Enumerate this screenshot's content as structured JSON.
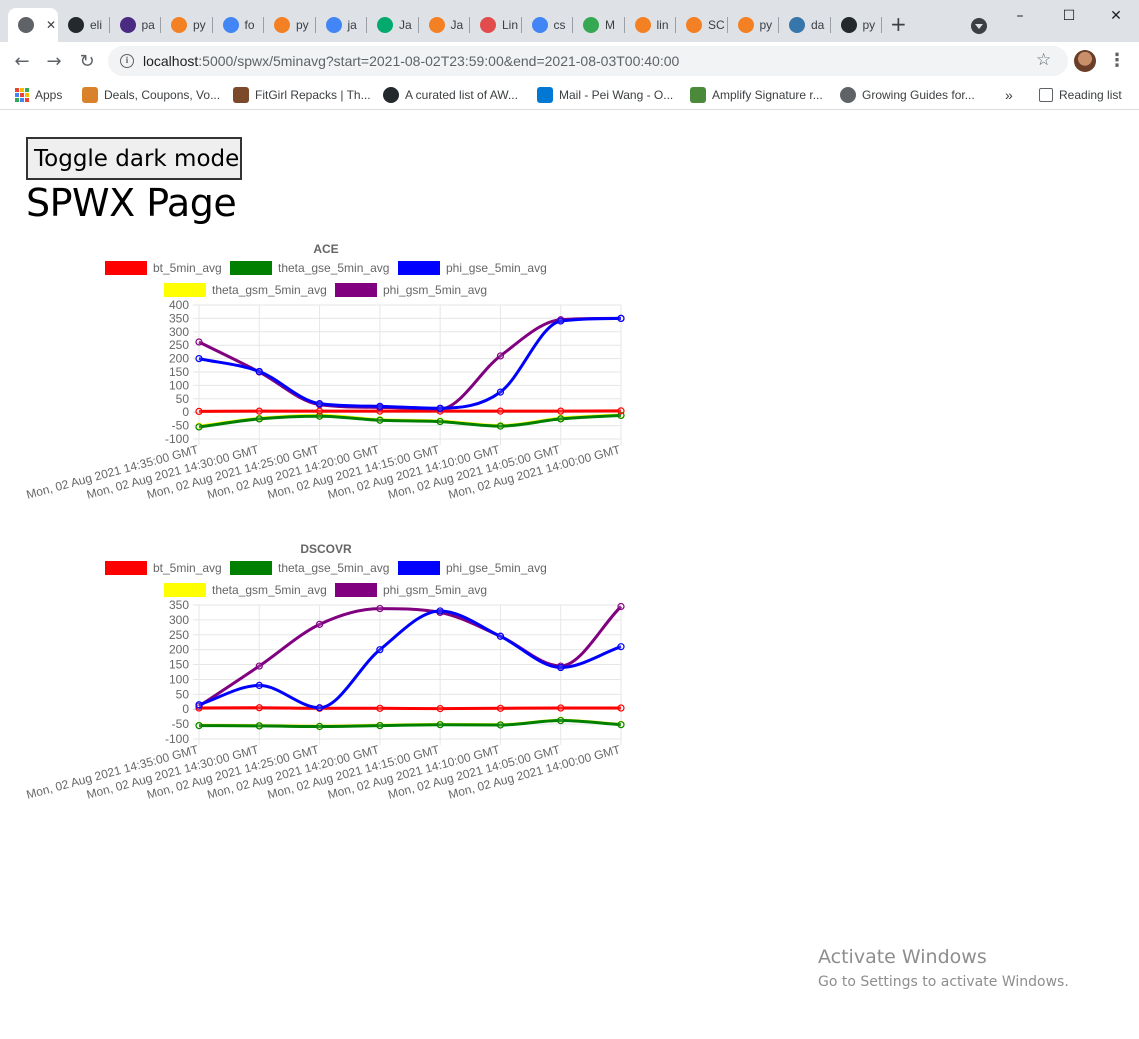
{
  "browser": {
    "tabs": [
      {
        "label": "",
        "icon": "globe-icon",
        "color": "#5f6368",
        "active": true
      },
      {
        "label": "eli",
        "icon": "github-icon",
        "color": "#24292e"
      },
      {
        "label": "pa",
        "icon": "bars-icon",
        "color": "#4b2a82"
      },
      {
        "label": "py",
        "icon": "stackoverflow-icon",
        "color": "#f48024"
      },
      {
        "label": "fo",
        "icon": "google-icon",
        "color": "#4285f4"
      },
      {
        "label": "py",
        "icon": "stackoverflow-icon",
        "color": "#f48024"
      },
      {
        "label": "ja",
        "icon": "google-icon",
        "color": "#4285f4"
      },
      {
        "label": "Ja",
        "icon": "w3schools-icon",
        "color": "#04aa6d"
      },
      {
        "label": "Ja",
        "icon": "stackoverflow-icon",
        "color": "#f48024"
      },
      {
        "label": "Lin",
        "icon": "heart-icon",
        "color": "#e24c4c"
      },
      {
        "label": "cs",
        "icon": "google-icon",
        "color": "#4285f4"
      },
      {
        "label": "M",
        "icon": "ring-icon",
        "color": "#34a853"
      },
      {
        "label": "lin",
        "icon": "stackoverflow-icon",
        "color": "#f48024"
      },
      {
        "label": "SC",
        "icon": "stackoverflow-icon",
        "color": "#f48024"
      },
      {
        "label": "py",
        "icon": "stackoverflow-icon",
        "color": "#f48024"
      },
      {
        "label": "da",
        "icon": "python-icon",
        "color": "#3776ab"
      },
      {
        "label": "py",
        "icon": "github-icon",
        "color": "#24292e"
      }
    ],
    "new_tab": "+",
    "window_controls": {
      "minimize": "–",
      "maximize": "☐",
      "close": "✕"
    },
    "url_host": "localhost",
    "url_rest": ":5000/spwx/5minavg?start=2021-08-02T23:59:00&end=2021-08-03T00:40:00",
    "bookmarks": [
      {
        "label": "Apps",
        "icon": "apps-icon"
      },
      {
        "label": "Deals, Coupons, Vo...",
        "icon": "oz-icon",
        "color": "#d9822b"
      },
      {
        "label": "FitGirl Repacks | Th...",
        "icon": "fitgirl-icon",
        "color": "#7a4a2a"
      },
      {
        "label": "A curated list of AW...",
        "icon": "github-icon",
        "color": "#24292e"
      },
      {
        "label": "Mail - Pei Wang - O...",
        "icon": "outlook-icon",
        "color": "#0078d4"
      },
      {
        "label": "Amplify Signature r...",
        "icon": "leaf-icon",
        "color": "#4a8a3a"
      },
      {
        "label": "Growing Guides for...",
        "icon": "globe-icon",
        "color": "#5f6368"
      },
      {
        "label": "»",
        "icon": "more-bookmarks-icon"
      },
      {
        "label": "Reading list",
        "icon": "reading-list-icon"
      }
    ]
  },
  "page": {
    "toggle_label": "Toggle dark mode",
    "title": "SPWX Page"
  },
  "chart_data": [
    {
      "type": "line",
      "title": "ACE",
      "x": [
        "Mon, 02 Aug 2021 14:35:00 GMT",
        "Mon, 02 Aug 2021 14:30:00 GMT",
        "Mon, 02 Aug 2021 14:25:00 GMT",
        "Mon, 02 Aug 2021 14:20:00 GMT",
        "Mon, 02 Aug 2021 14:15:00 GMT",
        "Mon, 02 Aug 2021 14:10:00 GMT",
        "Mon, 02 Aug 2021 14:05:00 GMT",
        "Mon, 02 Aug 2021 14:00:00 GMT"
      ],
      "ylim": [
        -100,
        400
      ],
      "yticks": [
        400,
        350,
        300,
        250,
        200,
        150,
        100,
        50,
        0,
        -50,
        -100
      ],
      "grid": true,
      "legend": "top",
      "series": [
        {
          "name": "bt_5min_avg",
          "color": "#ff0000",
          "values": [
            3,
            4,
            4,
            4,
            4,
            4,
            4,
            5
          ]
        },
        {
          "name": "theta_gse_5min_avg",
          "color": "#008000",
          "values": [
            -55,
            -25,
            -15,
            -30,
            -35,
            -52,
            -25,
            -12
          ]
        },
        {
          "name": "phi_gse_5min_avg",
          "color": "#0000ff",
          "values": [
            200,
            152,
            32,
            22,
            15,
            75,
            340,
            350
          ]
        },
        {
          "name": "theta_gsm_5min_avg",
          "color": "#ffff00",
          "values": [
            -52,
            -23,
            -12,
            -28,
            -33,
            -50,
            -22,
            -10
          ]
        },
        {
          "name": "phi_gsm_5min_avg",
          "color": "#800080",
          "values": [
            262,
            150,
            28,
            18,
            12,
            210,
            345,
            350
          ]
        }
      ]
    },
    {
      "type": "line",
      "title": "DSCOVR",
      "x": [
        "Mon, 02 Aug 2021 14:35:00 GMT",
        "Mon, 02 Aug 2021 14:30:00 GMT",
        "Mon, 02 Aug 2021 14:25:00 GMT",
        "Mon, 02 Aug 2021 14:20:00 GMT",
        "Mon, 02 Aug 2021 14:15:00 GMT",
        "Mon, 02 Aug 2021 14:10:00 GMT",
        "Mon, 02 Aug 2021 14:05:00 GMT",
        "Mon, 02 Aug 2021 14:00:00 GMT"
      ],
      "ylim": [
        -100,
        350
      ],
      "yticks": [
        350,
        300,
        250,
        200,
        150,
        100,
        50,
        0,
        -50,
        -100
      ],
      "grid": true,
      "legend": "top",
      "series": [
        {
          "name": "bt_5min_avg",
          "color": "#ff0000",
          "values": [
            4,
            5,
            3,
            3,
            2,
            3,
            4,
            4
          ]
        },
        {
          "name": "theta_gse_5min_avg",
          "color": "#008000",
          "values": [
            -55,
            -56,
            -58,
            -55,
            -52,
            -53,
            -38,
            -52
          ]
        },
        {
          "name": "phi_gse_5min_avg",
          "color": "#0000ff",
          "values": [
            15,
            80,
            5,
            200,
            330,
            245,
            140,
            210
          ]
        },
        {
          "name": "theta_gsm_5min_avg",
          "color": "#ffff00",
          "values": [
            -54,
            -55,
            -57,
            -54,
            -51,
            -52,
            -37,
            -51
          ]
        },
        {
          "name": "phi_gsm_5min_avg",
          "color": "#800080",
          "values": [
            10,
            145,
            285,
            338,
            325,
            245,
            145,
            345
          ]
        }
      ]
    }
  ],
  "watermark": {
    "line1": "Activate Windows",
    "line2": "Go to Settings to activate Windows."
  }
}
